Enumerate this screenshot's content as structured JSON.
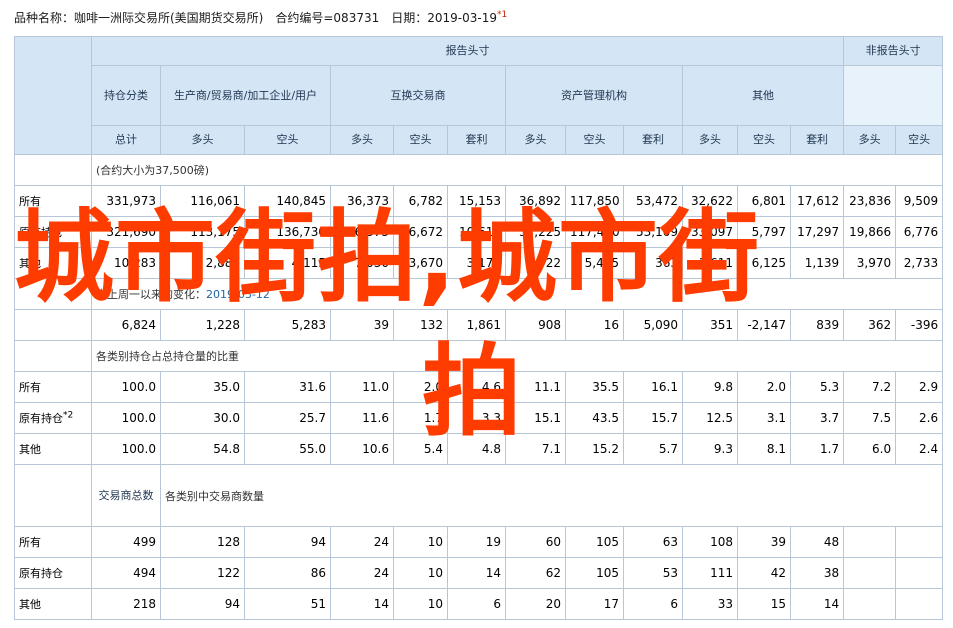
{
  "header": {
    "line": "品种名称：咖啡一洲际交易所(美国期货交易所)　合约编号=083731　日期：2019-03-19",
    "note_mark": "*1"
  },
  "groups": {
    "reportable": "报告头寸",
    "nonreportable": "非报告头寸",
    "holding_class": "持仓分类",
    "producer": "生产商/贸易商/加工企业/用户",
    "swap": "互换交易商",
    "managed": "资产管理机构",
    "other": "其他"
  },
  "subhead": {
    "total": "总计",
    "long": "多头",
    "short": "空头",
    "spread": "套利"
  },
  "notes": {
    "contract_size": "(合约大小为37,500磅)",
    "change_prefix": "自上周一以来的变化：",
    "change_date": "2019-03-12",
    "pct": "各类别持仓占总持仓量的比重",
    "trader_count": "各类别中交易商数量"
  },
  "trader_head": "交易商总数",
  "rows_position": [
    {
      "label": "所有",
      "mark": "",
      "total": "331,973",
      "prod_long": "116,061",
      "prod_short": "140,845",
      "swap_long": "36,373",
      "swap_short": "6,782",
      "swap_spread": "15,153",
      "mm_long": "36,892",
      "mm_short": "117,850",
      "mm_spread": "53,472",
      "oth_long": "32,622",
      "oth_short": "6,801",
      "oth_spread": "17,612",
      "nr_long": "23,836",
      "nr_short": "9,509"
    },
    {
      "label": "原有持仓",
      "mark": "",
      "total": "321,690",
      "prod_long": "113,175",
      "prod_short": "136,730",
      "swap_long": "36,373",
      "swap_short": "6,672",
      "swap_spread": "10,619",
      "mm_long": "37,225",
      "mm_short": "117,460",
      "mm_spread": "53,109",
      "oth_long": "33,097",
      "oth_short": "5,797",
      "oth_spread": "17,297",
      "nr_long": "19,866",
      "nr_short": "6,776"
    },
    {
      "label": "其他",
      "mark": "",
      "total": "10,283",
      "prod_long": "2,886",
      "prod_short": "4,115",
      "swap_long": "7,030",
      "swap_short": "3,670",
      "swap_spread": "3,173",
      "mm_long": "4,722",
      "mm_short": "5,445",
      "mm_spread": "363",
      "oth_long": "1,611",
      "oth_short": "6,125",
      "oth_spread": "1,139",
      "nr_long": "3,970",
      "nr_short": "2,733"
    }
  ],
  "change_row": {
    "total": "6,824",
    "prod_long": "1,228",
    "prod_short": "5,283",
    "swap_long": "39",
    "swap_short": "132",
    "swap_spread": "1,861",
    "mm_long": "908",
    "mm_short": "16",
    "mm_spread": "5,090",
    "oth_long": "351",
    "oth_short": "-2,147",
    "oth_spread": "839",
    "nr_long": "362",
    "nr_short": "-396"
  },
  "rows_pct": [
    {
      "label": "所有",
      "mark": "",
      "total": "100.0",
      "prod_long": "35.0",
      "prod_short": "31.6",
      "swap_long": "11.0",
      "swap_short": "2.0",
      "swap_spread": "4.6",
      "mm_long": "11.1",
      "mm_short": "35.5",
      "mm_spread": "16.1",
      "oth_long": "9.8",
      "oth_short": "2.0",
      "oth_spread": "5.3",
      "nr_long": "7.2",
      "nr_short": "2.9"
    },
    {
      "label": "原有持仓",
      "mark": "*2",
      "total": "100.0",
      "prod_long": "30.0",
      "prod_short": "25.7",
      "swap_long": "11.6",
      "swap_short": "1.7",
      "swap_spread": "3.3",
      "mm_long": "15.1",
      "mm_short": "43.5",
      "mm_spread": "15.7",
      "oth_long": "12.5",
      "oth_short": "3.1",
      "oth_spread": "3.7",
      "nr_long": "7.5",
      "nr_short": "2.6"
    },
    {
      "label": "其他",
      "mark": "",
      "total": "100.0",
      "prod_long": "54.8",
      "prod_short": "55.0",
      "swap_long": "10.6",
      "swap_short": "5.4",
      "swap_spread": "4.8",
      "mm_long": "7.1",
      "mm_short": "15.2",
      "mm_spread": "5.7",
      "oth_long": "9.3",
      "oth_short": "8.1",
      "oth_spread": "1.7",
      "nr_long": "6.0",
      "nr_short": "2.4"
    }
  ],
  "rows_count": [
    {
      "label": "所有",
      "mark": "",
      "total": "499",
      "prod_long": "128",
      "prod_short": "94",
      "swap_long": "24",
      "swap_short": "10",
      "swap_spread": "19",
      "mm_long": "60",
      "mm_short": "105",
      "mm_spread": "63",
      "oth_long": "108",
      "oth_short": "39",
      "oth_spread": "48",
      "nr_long": "",
      "nr_short": ""
    },
    {
      "label": "原有持仓",
      "mark": "",
      "total": "494",
      "prod_long": "122",
      "prod_short": "86",
      "swap_long": "24",
      "swap_short": "10",
      "swap_spread": "14",
      "mm_long": "62",
      "mm_short": "105",
      "mm_spread": "53",
      "oth_long": "111",
      "oth_short": "42",
      "oth_spread": "38",
      "nr_long": "",
      "nr_short": ""
    },
    {
      "label": "其他",
      "mark": "",
      "total": "218",
      "prod_long": "94",
      "prod_short": "51",
      "swap_long": "14",
      "swap_short": "10",
      "swap_spread": "6",
      "mm_long": "20",
      "mm_short": "17",
      "mm_spread": "6",
      "oth_long": "33",
      "oth_short": "15",
      "oth_spread": "14",
      "nr_long": "",
      "nr_short": ""
    }
  ],
  "watermark": {
    "line1": "城市街拍,城市街",
    "line2": "拍"
  }
}
